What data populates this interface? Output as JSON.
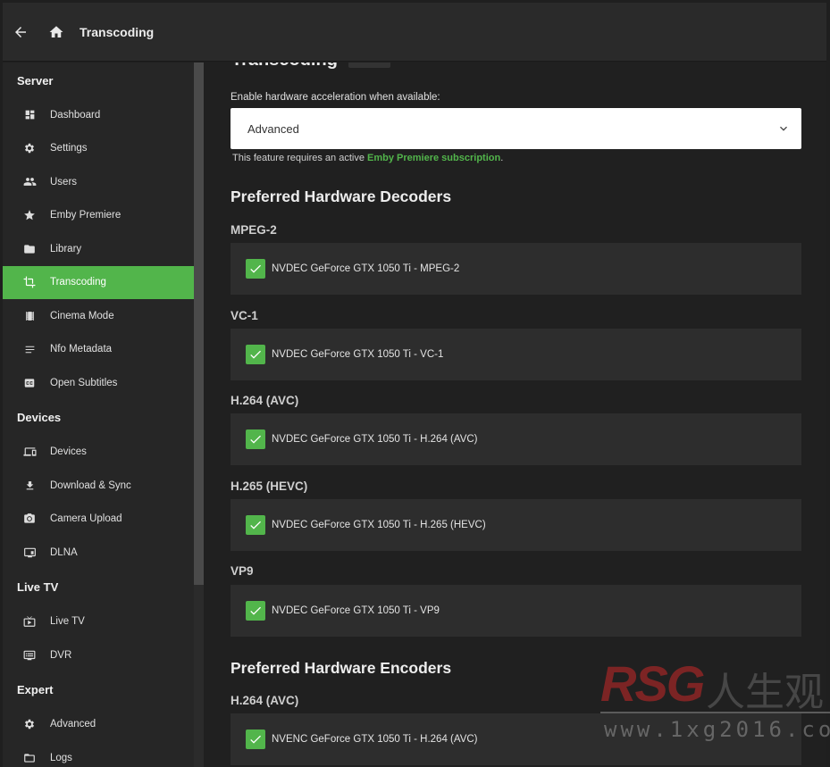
{
  "header": {
    "title": "Transcoding"
  },
  "sidebar": {
    "sections": [
      {
        "title": "Server",
        "items": [
          {
            "label": "Dashboard",
            "icon": "dashboard-icon"
          },
          {
            "label": "Settings",
            "icon": "gear-icon"
          },
          {
            "label": "Users",
            "icon": "people-icon"
          },
          {
            "label": "Emby Premiere",
            "icon": "star-icon"
          },
          {
            "label": "Library",
            "icon": "folder-icon"
          },
          {
            "label": "Transcoding",
            "icon": "crop-icon",
            "active": true
          },
          {
            "label": "Cinema Mode",
            "icon": "film-icon"
          },
          {
            "label": "Nfo Metadata",
            "icon": "lines-icon"
          },
          {
            "label": "Open Subtitles",
            "icon": "subtitles-icon"
          }
        ]
      },
      {
        "title": "Devices",
        "items": [
          {
            "label": "Devices",
            "icon": "devices-icon"
          },
          {
            "label": "Download & Sync",
            "icon": "download-icon"
          },
          {
            "label": "Camera Upload",
            "icon": "camera-icon"
          },
          {
            "label": "DLNA",
            "icon": "dlna-icon"
          }
        ]
      },
      {
        "title": "Live TV",
        "items": [
          {
            "label": "Live TV",
            "icon": "live-tv-icon"
          },
          {
            "label": "DVR",
            "icon": "dvr-icon"
          }
        ]
      },
      {
        "title": "Expert",
        "items": [
          {
            "label": "Advanced",
            "icon": "gear-icon"
          },
          {
            "label": "Logs",
            "icon": "folder-outline-icon"
          }
        ]
      }
    ]
  },
  "main": {
    "page_title": "Transcoding",
    "hw_accel_label": "Enable hardware acceleration when available:",
    "hw_accel_value": "Advanced",
    "note_prefix": "This feature requires an active ",
    "note_link": "Emby Premiere subscription",
    "note_suffix": ".",
    "decoders_title": "Preferred Hardware Decoders",
    "decoders": [
      {
        "codec": "MPEG-2",
        "option": "NVDEC GeForce GTX 1050 Ti - MPEG-2",
        "checked": true
      },
      {
        "codec": "VC-1",
        "option": "NVDEC GeForce GTX 1050 Ti - VC-1",
        "checked": true
      },
      {
        "codec": "H.264 (AVC)",
        "option": "NVDEC GeForce GTX 1050 Ti - H.264 (AVC)",
        "checked": true
      },
      {
        "codec": "H.265 (HEVC)",
        "option": "NVDEC GeForce GTX 1050 Ti - H.265 (HEVC)",
        "checked": true
      },
      {
        "codec": "VP9",
        "option": "NVDEC GeForce GTX 1050 Ti - VP9",
        "checked": true
      }
    ],
    "encoders_title": "Preferred Hardware Encoders",
    "encoders": [
      {
        "codec": "H.264 (AVC)",
        "option": "NVENC GeForce GTX 1050 Ti - H.264 (AVC)",
        "checked": true
      }
    ]
  },
  "watermark": {
    "logo": "RSG",
    "cn": "人生观",
    "url": "www.1xg2016.com"
  },
  "colors": {
    "accent": "#52b54b",
    "bg": "#202020",
    "card": "#2d2d2d"
  }
}
